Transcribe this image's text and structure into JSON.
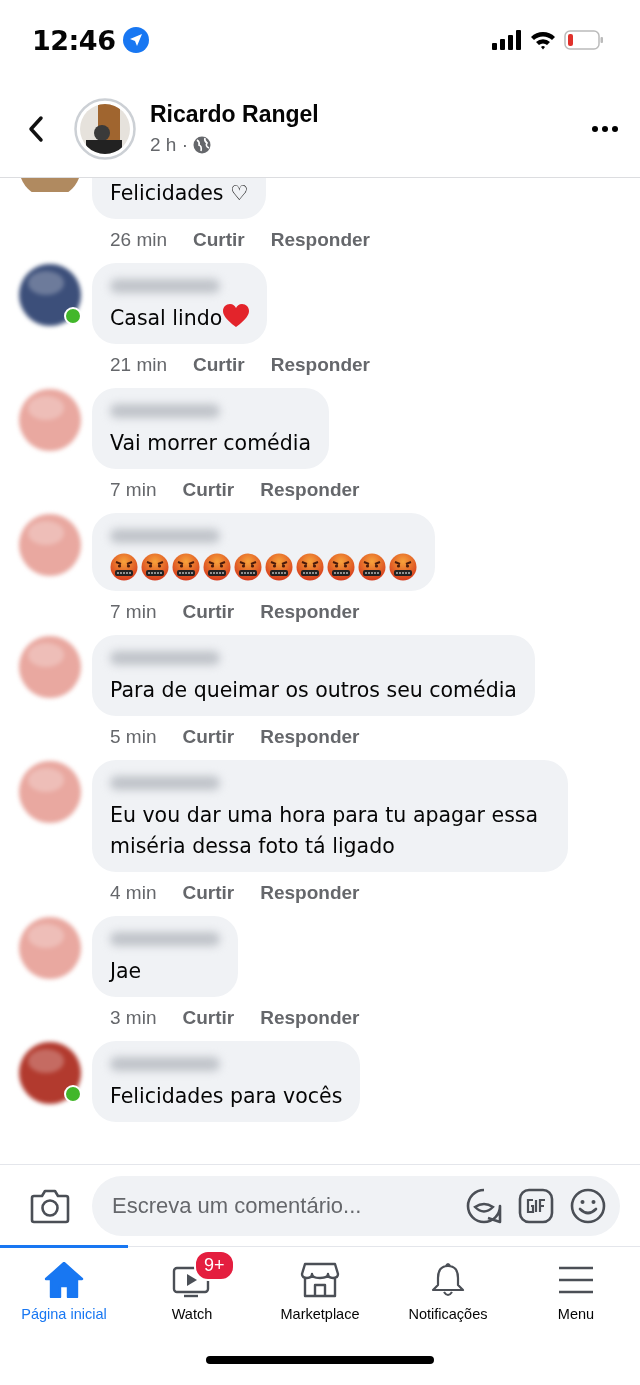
{
  "status_bar": {
    "time": "12:46"
  },
  "header": {
    "title": "Ricardo Rangel",
    "subtitle": "2 h ·"
  },
  "comments": [
    {
      "kind": "cut",
      "online": false,
      "text": "Felicidades ♡",
      "time": "26 min",
      "like": "Curtir",
      "reply": "Responder"
    },
    {
      "kind": "text_heart",
      "online": true,
      "text": "Casal lindo",
      "time": "21 min",
      "like": "Curtir",
      "reply": "Responder"
    },
    {
      "kind": "text",
      "online": false,
      "text": "Vai morrer comédia",
      "time": "7 min",
      "like": "Curtir",
      "reply": "Responder"
    },
    {
      "kind": "faces",
      "online": false,
      "faces": [
        {
          "kind": "cursing"
        },
        {
          "kind": "cursing"
        },
        {
          "kind": "cursing"
        },
        {
          "kind": "cursing"
        },
        {
          "kind": "cursing"
        },
        {
          "kind": "cursing"
        },
        {
          "kind": "cursing"
        },
        {
          "kind": "cursing"
        },
        {
          "kind": "cursing"
        },
        {
          "kind": "cursing"
        }
      ],
      "time": "7 min",
      "like": "Curtir",
      "reply": "Responder"
    },
    {
      "kind": "text",
      "online": false,
      "text": "Para de queimar os outros seu comédia",
      "time": "5 min",
      "like": "Curtir",
      "reply": "Responder"
    },
    {
      "kind": "text",
      "online": false,
      "text": "Eu vou dar uma hora para tu apagar essa miséria dessa foto tá ligado",
      "time": "4 min",
      "like": "Curtir",
      "reply": "Responder"
    },
    {
      "kind": "text",
      "online": false,
      "text": "Jae",
      "time": "3 min",
      "like": "Curtir",
      "reply": "Responder"
    },
    {
      "kind": "text",
      "online": true,
      "text": "Felicidades para vocês"
    }
  ],
  "composer": {
    "placeholder": "Escreva um comentário..."
  },
  "tabs": [
    {
      "label": "Página inicial",
      "selected": true
    },
    {
      "label": "Watch",
      "selected": false,
      "badge": "9+"
    },
    {
      "label": "Marketplace",
      "selected": false
    },
    {
      "label": "Notificações",
      "selected": false
    },
    {
      "label": "Menu",
      "selected": false
    }
  ]
}
